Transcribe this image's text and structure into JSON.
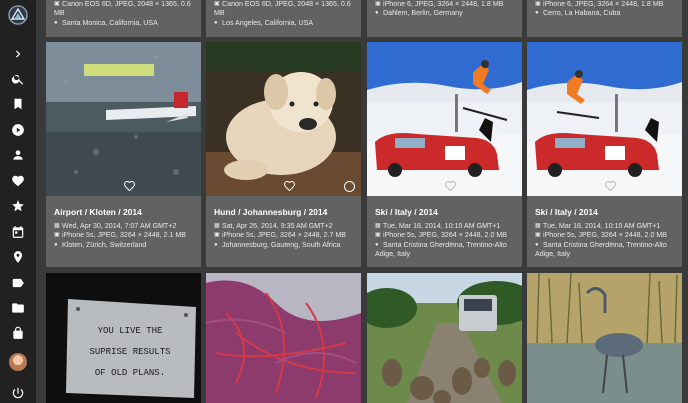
{
  "sidebar": {
    "items": [
      {
        "name": "expand-icon"
      },
      {
        "name": "search-icon"
      },
      {
        "name": "bookmark-icon"
      },
      {
        "name": "play-icon"
      },
      {
        "name": "person-icon"
      },
      {
        "name": "heart-icon"
      },
      {
        "name": "star-icon"
      },
      {
        "name": "calendar-icon"
      },
      {
        "name": "location-icon"
      },
      {
        "name": "label-icon"
      },
      {
        "name": "folder-icon"
      },
      {
        "name": "lock-icon"
      },
      {
        "name": "avatar"
      },
      {
        "name": "power-icon"
      }
    ]
  },
  "top_row": [
    {
      "camera": "Canon EOS 6D, JPEG, 2048 × 1365, 0.6",
      "camera_cont": "MB",
      "location": "Santa Monica, California, USA"
    },
    {
      "camera": "Canon EOS 6D, JPEG, 2048 × 1365, 0.6",
      "camera_cont": "MB",
      "location": "Los Angeles, California, USA"
    },
    {
      "camera": "iPhone 6, JPEG, 3264 × 2448, 1.8 MB",
      "location": "Dahlem, Berlin, Germany"
    },
    {
      "camera": "iPhone 6, JPEG, 3264 × 2448, 1.8 MB",
      "location": "Cerro, La Habana, Cuba"
    }
  ],
  "photos": [
    {
      "title": "Airport / Kloten / 2014",
      "date": "Wed, Apr 30, 2014, 7:07 AM GMT+2",
      "camera": "iPhone 5s, JPEG, 3264 × 2448, 2.1 MB",
      "location": "Kloten, Zürich, Switzerland",
      "location_cont": ""
    },
    {
      "title": "Hund / Johannesburg / 2014",
      "date": "Sat, Apr 26, 2014, 9:35 AM GMT+2",
      "camera": "iPhone 5s, JPEG, 3264 × 2448, 2.7 MB",
      "location": "Johannesburg, Gauteng, South Africa",
      "location_cont": ""
    },
    {
      "title": "Ski / Italy / 2014",
      "date": "Tue, Mar 18, 2014, 10:10 AM GMT+1",
      "camera": "iPhone 5s, JPEG, 3264 × 2448, 2.0 MB",
      "location": "Santa Cristina Gherdëina, Trentino-Alto",
      "location_cont": "Adige, Italy"
    },
    {
      "title": "Ski / Italy / 2014",
      "date": "Tue, Mar 18, 2014, 10:10 AM GMT+1",
      "camera": "iPhone 5s, JPEG, 3264 × 2448, 2.0 MB",
      "location": "Santa Cristina Gherdëina, Trentino-Alto",
      "location_cont": "Adige, Italy"
    }
  ],
  "bottom_row": [
    {
      "sign_lines": [
        "YOU LIVE THE",
        "SUPRISE RESULTS",
        "OF OLD PLANS."
      ]
    },
    {},
    {},
    {}
  ],
  "colors": {
    "sidebar": "#212121",
    "background": "#3a3a3a",
    "card": "#626262",
    "text": "#e8e8e8"
  }
}
